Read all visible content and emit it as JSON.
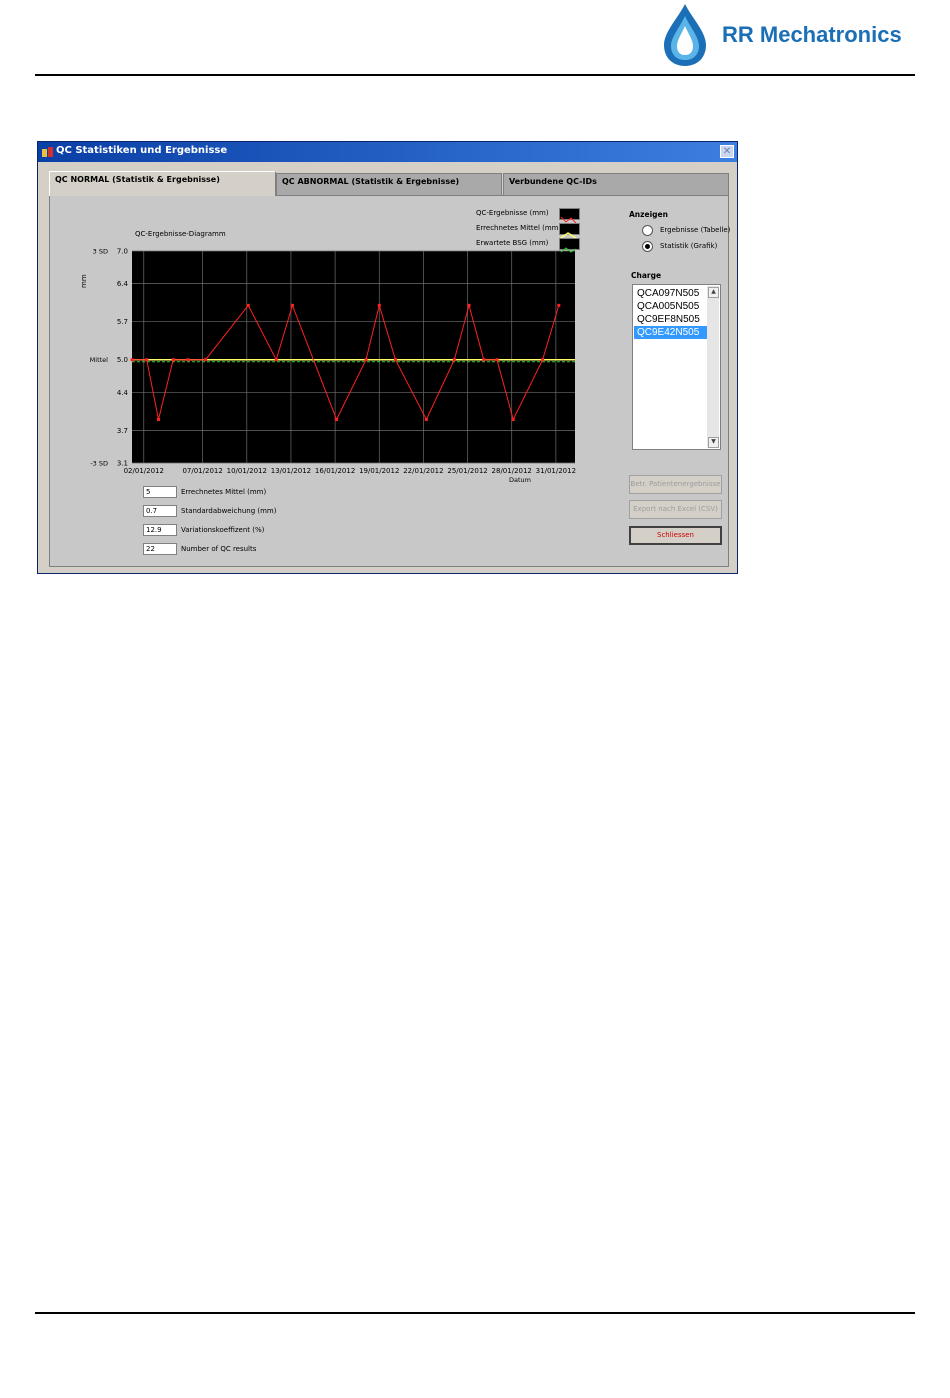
{
  "brand": {
    "name": "RR Mechatronics",
    "color": "#1a6fb7"
  },
  "window": {
    "title": "QC Statistiken und Ergebnisse",
    "close_icon": "close-icon"
  },
  "tabs": [
    {
      "label": "QC NORMAL (Statistik & Ergebnisse)",
      "active": true
    },
    {
      "label": "QC ABNORMAL (Statistik & Ergebnisse)",
      "active": false
    },
    {
      "label": "Verbundene QC-IDs",
      "active": false
    }
  ],
  "chart_panel": {
    "diagram_label": "QC-Ergebnisse-Diagramm",
    "y_unit": "mm",
    "sd_labels": {
      "upper": "3 SD",
      "mean": "Mittel",
      "lower": "-3 SD"
    },
    "legend": [
      {
        "label": "QC-Ergebnisse (mm)",
        "color": "#ff2020"
      },
      {
        "label": "Errechnetes Mittel (mm)",
        "color": "#ffff66"
      },
      {
        "label": "Erwartete BSG (mm)",
        "color": "#33cc33"
      }
    ]
  },
  "chart_data": {
    "type": "line",
    "xlabel": "Datum",
    "ylabel": "mm",
    "ylim": [
      3.1,
      7.0
    ],
    "yticks": [
      "7.0",
      "6.4",
      "5.7",
      "5.0",
      "4.4",
      "3.7",
      "3.1"
    ],
    "ytick_values": [
      7.0,
      6.4,
      5.7,
      5.0,
      4.4,
      3.7,
      3.1
    ],
    "xlim": [
      1.2,
      31.3
    ],
    "xticks": [
      "02/01/2012",
      "07/01/2012",
      "10/01/2012",
      "13/01/2012",
      "16/01/2012",
      "19/01/2012",
      "22/01/2012",
      "25/01/2012",
      "28/01/2012",
      "31/01/2012"
    ],
    "xtick_days": [
      2,
      6,
      9,
      12,
      15,
      18,
      21,
      24,
      27,
      30
    ],
    "grid": true,
    "series": [
      {
        "name": "QC-Ergebnisse (mm)",
        "color": "#ff2020",
        "x": [
          1.2,
          2.2,
          3.0,
          4.0,
          5.0,
          6.2,
          9.1,
          11.0,
          12.1,
          15.1,
          17.1,
          18.0,
          19.1,
          21.2,
          23.1,
          24.1,
          25.1,
          26.0,
          27.1,
          29.1,
          30.2
        ],
        "y": [
          5.0,
          5.0,
          3.9,
          5.0,
          5.0,
          5.0,
          6.0,
          5.0,
          6.0,
          3.9,
          5.0,
          6.0,
          5.0,
          3.9,
          5.0,
          6.0,
          5.0,
          5.0,
          3.9,
          5.0,
          6.0
        ]
      },
      {
        "name": "Errechnetes Mittel (mm)",
        "color": "#ffff66",
        "x": [
          1.2,
          31.3
        ],
        "y": [
          5.0,
          5.0
        ]
      },
      {
        "name": "Erwartete BSG (mm)",
        "color": "#33cc33",
        "x": [
          1.2,
          31.3
        ],
        "y": [
          5.0,
          5.0
        ]
      }
    ]
  },
  "display": {
    "title": "Anzeigen",
    "options": [
      {
        "label": "Ergebnisse (Tabelle)",
        "selected": false
      },
      {
        "label": "Statistik (Grafik)",
        "selected": true
      }
    ]
  },
  "charge": {
    "title": "Charge",
    "items": [
      "QCA097N505",
      "QCA005N505",
      "QC9EF8N505",
      "QC9E42N505"
    ],
    "selected_index": 3
  },
  "buttons": {
    "patient_results": "Betr. Patientenergebnisse",
    "export": "Export nach Excel (CSV)",
    "close": "Schliessen"
  },
  "stats": [
    {
      "value": "5",
      "label": "Errechnetes Mittel (mm)"
    },
    {
      "value": "0.7",
      "label": "Standardabweichung (mm)"
    },
    {
      "value": "12.9",
      "label": "Variationskoeffizent (%)"
    },
    {
      "value": "22",
      "label": "Number of QC results"
    }
  ]
}
